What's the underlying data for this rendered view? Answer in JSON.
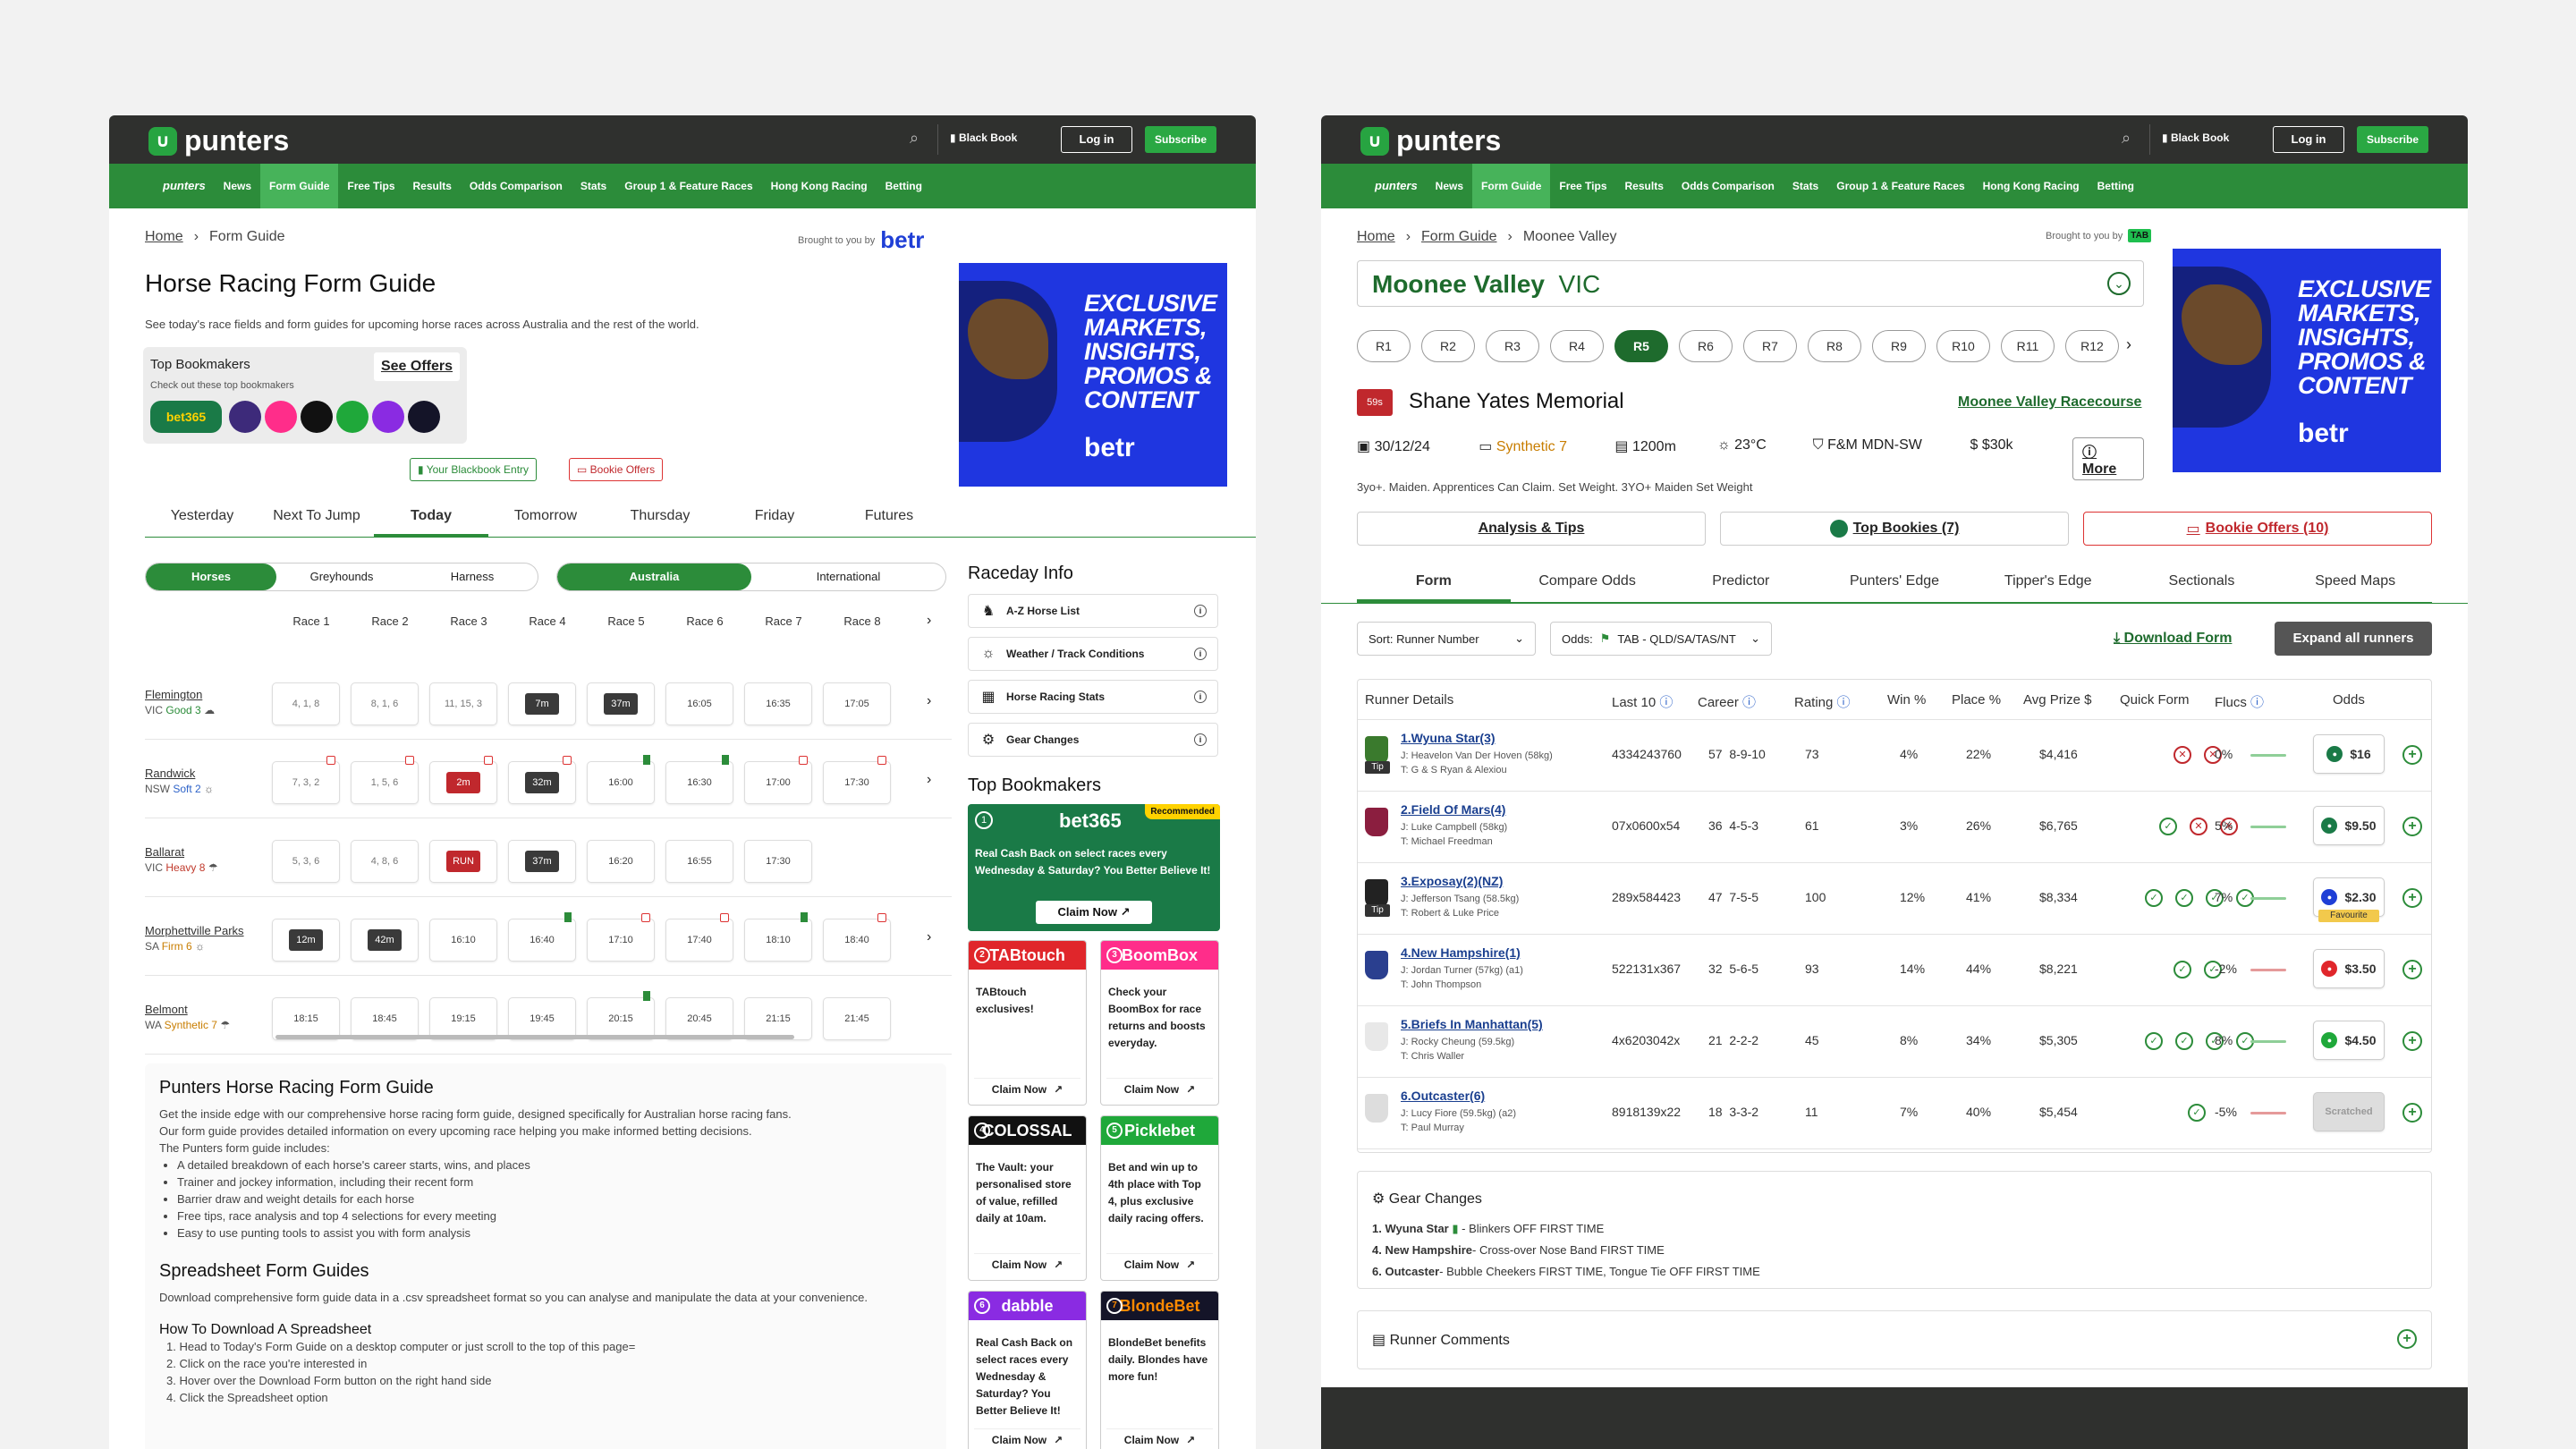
{
  "brand": {
    "name": "punters",
    "nav_brand": "punters"
  },
  "topbar": {
    "black_book": "Black Book",
    "login": "Log in",
    "subscribe": "Subscribe"
  },
  "nav": {
    "items": [
      "News",
      "Form Guide",
      "Free Tips",
      "Results",
      "Odds Comparison",
      "Stats",
      "Group 1 & Feature Races",
      "Hong Kong Racing",
      "Betting"
    ],
    "active": "Form Guide"
  },
  "left": {
    "breadcrumb": [
      "Home",
      "Form Guide"
    ],
    "brought_by": "Brought to you by",
    "sponsor": "betr",
    "title": "Horse Racing Form Guide",
    "intro": "See today's race fields and form guides for upcoming horse races across Australia and the rest of the world.",
    "top_bookmakers": {
      "title": "Top Bookmakers",
      "subtitle": "Check out these top bookmakers",
      "cta": "See Offers"
    },
    "blackbook_btn": "Your Blackbook Entry",
    "bookie_btn": "Bookie Offers",
    "ad": {
      "lines": [
        "EXCLUSIVE",
        "MARKETS,",
        "INSIGHTS,",
        "PROMOS &",
        "CONTENT"
      ],
      "logo": "betr"
    },
    "day_tabs": [
      "Yesterday",
      "Next To Jump",
      "Today",
      "Tomorrow",
      "Thursday",
      "Friday",
      "Futures"
    ],
    "day_active": "Today",
    "type_seg": [
      "Horses",
      "Greyhounds",
      "Harness"
    ],
    "region_seg": [
      "Australia",
      "International"
    ],
    "race_headers": [
      "Race 1",
      "Race 2",
      "Race 3",
      "Race 4",
      "Race 5",
      "Race 6",
      "Race 7",
      "Race 8"
    ],
    "tracks": [
      {
        "name": "Flemington",
        "state": "VIC",
        "cond": "Good 3",
        "cond_color": "g",
        "cells": [
          "4, 1, 8",
          "8, 1, 6",
          "11, 15, 3",
          "7m",
          "37m",
          "16:05",
          "16:35",
          "17:05"
        ]
      },
      {
        "name": "Randwick",
        "state": "NSW",
        "cond": "Soft 2",
        "cond_color": "b",
        "cells": [
          "7, 3, 2",
          "1, 5, 6",
          "2m",
          "32m",
          "16:00",
          "16:30",
          "17:00",
          "17:30"
        ]
      },
      {
        "name": "Ballarat",
        "state": "VIC",
        "cond": "Heavy 8",
        "cond_color": "r",
        "cells": [
          "5, 3, 6",
          "4, 8, 6",
          "RUN",
          "37m",
          "16:20",
          "16:55",
          "17:30",
          ""
        ]
      },
      {
        "name": "Morphettville Parks",
        "state": "SA",
        "cond": "Firm 6",
        "cond_color": "o",
        "cells": [
          "12m",
          "42m",
          "16:10",
          "16:40",
          "17:10",
          "17:40",
          "18:10",
          "18:40"
        ]
      },
      {
        "name": "Belmont",
        "state": "WA",
        "cond": "Synthetic 7",
        "cond_color": "o",
        "cells": [
          "18:15",
          "18:45",
          "19:15",
          "19:45",
          "20:15",
          "20:45",
          "21:15",
          "21:45"
        ]
      }
    ],
    "raceday": {
      "title": "Raceday Info",
      "items": [
        "A-Z Horse List",
        "Weather / Track Conditions",
        "Horse Racing Stats",
        "Gear Changes"
      ]
    },
    "bookies": {
      "title": "Top Bookmakers",
      "recommended": "Recommended",
      "claim": "Claim Now",
      "list": [
        {
          "name": "bet365",
          "text": "Real Cash Back on select races every Wednesday & Saturday? You Better Believe It!",
          "color": "#1a7a47"
        },
        {
          "name": "TABtouch",
          "text": "TABtouch exclusives!",
          "color": "#e0262b"
        },
        {
          "name": "BoomBox",
          "text": "Check your BoomBox for race returns and boosts everyday.",
          "color": "#ff2d8a"
        },
        {
          "name": "COLOSSAL",
          "text": "The Vault: your personalised store of value, refilled daily at 10am.",
          "color": "#111111"
        },
        {
          "name": "Picklebet",
          "text": "Bet and win up to 4th place with Top 4, plus exclusive daily racing offers.",
          "color": "#1fa83a"
        },
        {
          "name": "dabble",
          "text": "Real Cash Back on select races every Wednesday & Saturday? You Better Believe It!",
          "color": "#8a2be2"
        },
        {
          "name": "BlondeBet",
          "text": "BlondeBet benefits daily. Blondes have more fun!",
          "color": "#141428"
        }
      ]
    },
    "article": {
      "h1": "Punters Horse Racing Form Guide",
      "p1": "Get the inside edge with our comprehensive horse racing form guide, designed specifically for Australian horse racing fans.",
      "p2": "Our form guide provides detailed information on every upcoming race helping you make informed betting decisions.",
      "p3": "The Punters form guide includes:",
      "bullets": [
        "A detailed breakdown of each horse's career starts, wins, and places",
        "Trainer and jockey information, including their recent form",
        "Barrier draw and weight details for each horse",
        "Free tips, race analysis and top 4 selections for every meeting",
        "Easy to use punting tools to assist you with form analysis"
      ],
      "h2": "Spreadsheet Form Guides",
      "p4": "Download comprehensive form guide data in a .csv spreadsheet format so you can analyse and manipulate the data at your convenience.",
      "h3": "How To Download A Spreadsheet",
      "steps": [
        "1. Head to Today's Form Guide on a desktop computer or just scroll to the top of this page=",
        "2. Click on the race you're interested in",
        "3. Hover over the Download Form button on the right hand side",
        "4. Click the Spreadsheet option"
      ]
    }
  },
  "right": {
    "breadcrumb": [
      "Home",
      "Form Guide",
      "Moonee Valley"
    ],
    "brought_by": "Brought to you by",
    "sponsor": "TAB",
    "venue": "Moonee Valley",
    "state": "VIC",
    "races": [
      "R1",
      "R2",
      "R3",
      "R4",
      "R5",
      "R6",
      "R7",
      "R8",
      "R9",
      "R10",
      "R11",
      "R12"
    ],
    "active_race": "R5",
    "race_time": "59s",
    "race_name": "Shane Yates Memorial",
    "racecourse_link": "Moonee Valley Racecourse",
    "date": "30/12/24",
    "track": "Synthetic 7",
    "distance": "1200m",
    "temp": "23°C",
    "class": "F&M MDN-SW",
    "prize": "$30k",
    "more": "More",
    "conditions": "3yo+. Maiden. Apprentices Can Claim. Set Weight. 3YO+ Maiden Set Weight",
    "buttons": [
      "Analysis & Tips",
      "Top Bookies (7)",
      "Bookie Offers (10)"
    ],
    "tabs": [
      "Form",
      "Compare Odds",
      "Predictor",
      "Punters' Edge",
      "Tipper's Edge",
      "Sectionals",
      "Speed Maps"
    ],
    "tab_active": "Form",
    "sort": "Sort: Runner Number",
    "odds_label": "Odds:",
    "odds_source": "TAB - QLD/SA/TAS/NT",
    "download": "Download Form",
    "expand": "Expand all runners",
    "columns": [
      "Runner Details",
      "Last 10",
      "Career",
      "Rating",
      "Win %",
      "Place %",
      "Avg Prize $",
      "Quick Form",
      "Flucs",
      "Odds"
    ],
    "runners": [
      {
        "name": "1.Wyuna Star(3)",
        "jockey": "J: Heavelon Van Der Hoven (58kg)",
        "trainer": "T: G & S Ryan & Alexiou",
        "last10": "4334243760",
        "career": "57  8-9-10",
        "rating": "73",
        "win": "4%",
        "place": "22%",
        "avg": "$4,416",
        "qf": [
          "no",
          "no"
        ],
        "fluc": "0%",
        "odds": "$16",
        "tip": "Tip",
        "bk_color": "#1a7a47"
      },
      {
        "name": "2.Field Of Mars(4)",
        "jockey": "J: Luke Campbell (58kg)",
        "trainer": "T: Michael Freedman",
        "last10": "07x0600x54",
        "career": "36  4-5-3",
        "rating": "61",
        "win": "3%",
        "place": "26%",
        "avg": "$6,765",
        "qf": [
          "ok",
          "no",
          "no"
        ],
        "fluc": "5%",
        "odds": "$9.50",
        "tip": "",
        "bk_color": "#1a7a47"
      },
      {
        "name": "3.Exposay(2)(NZ)",
        "jockey": "J: Jefferson Tsang (58.5kg)",
        "trainer": "T: Robert & Luke Price",
        "last10": "289x584423",
        "career": "47  7-5-5",
        "rating": "100",
        "win": "12%",
        "place": "41%",
        "avg": "$8,334",
        "qf": [
          "ok",
          "ok",
          "ok",
          "ok"
        ],
        "fluc": "7%",
        "odds": "$2.30",
        "tip": "Tip",
        "favourite": "Favourite",
        "bk_color": "#1f3fd6"
      },
      {
        "name": "4.New Hampshire(1)",
        "jockey": "J: Jordan Turner (57kg) (a1)",
        "trainer": "T: John Thompson",
        "last10": "522131x367",
        "career": "32  5-6-5",
        "rating": "93",
        "win": "14%",
        "place": "44%",
        "avg": "$8,221",
        "qf": [
          "ok",
          "ok"
        ],
        "fluc": "-2%",
        "odds": "$3.50",
        "tip": "",
        "bk_color": "#e0262b"
      },
      {
        "name": "5.Briefs In Manhattan(5)",
        "jockey": "J: Rocky Cheung (59.5kg)",
        "trainer": "T: Chris Waller",
        "last10": "4x6203042x",
        "career": "21  2-2-2",
        "rating": "45",
        "win": "8%",
        "place": "34%",
        "avg": "$5,305",
        "qf": [
          "ok",
          "ok",
          "ok",
          "ok"
        ],
        "fluc": "8%",
        "odds": "$4.50",
        "tip": "",
        "bk_color": "#1fa83a"
      },
      {
        "name": "6.Outcaster(6)",
        "jockey": "J: Lucy Fiore (59.5kg) (a2)",
        "trainer": "T: Paul Murray",
        "last10": "8918139x22",
        "career": "18  3-3-2",
        "rating": "11",
        "win": "7%",
        "place": "40%",
        "avg": "$5,454",
        "qf": [
          "ok"
        ],
        "fluc": "-5%",
        "odds": "Scratched",
        "tip": "",
        "bk_color": ""
      }
    ],
    "gear": {
      "title": "Gear Changes",
      "items": [
        {
          "horse": "1. Wyuna Star",
          "text": "- Blinkers OFF FIRST TIME"
        },
        {
          "horse": "4. New Hampshire",
          "text": "- Cross-over Nose Band FIRST TIME"
        },
        {
          "horse": "6. Outcaster",
          "text": "- Bubble Cheekers FIRST TIME, Tongue Tie OFF FIRST TIME"
        }
      ]
    },
    "comments": {
      "title": "Runner Comments"
    },
    "ad": {
      "lines": [
        "EXCLUSIVE",
        "MARKETS,",
        "INSIGHTS,",
        "PROMOS &",
        "CONTENT"
      ],
      "logo": "betr"
    }
  }
}
